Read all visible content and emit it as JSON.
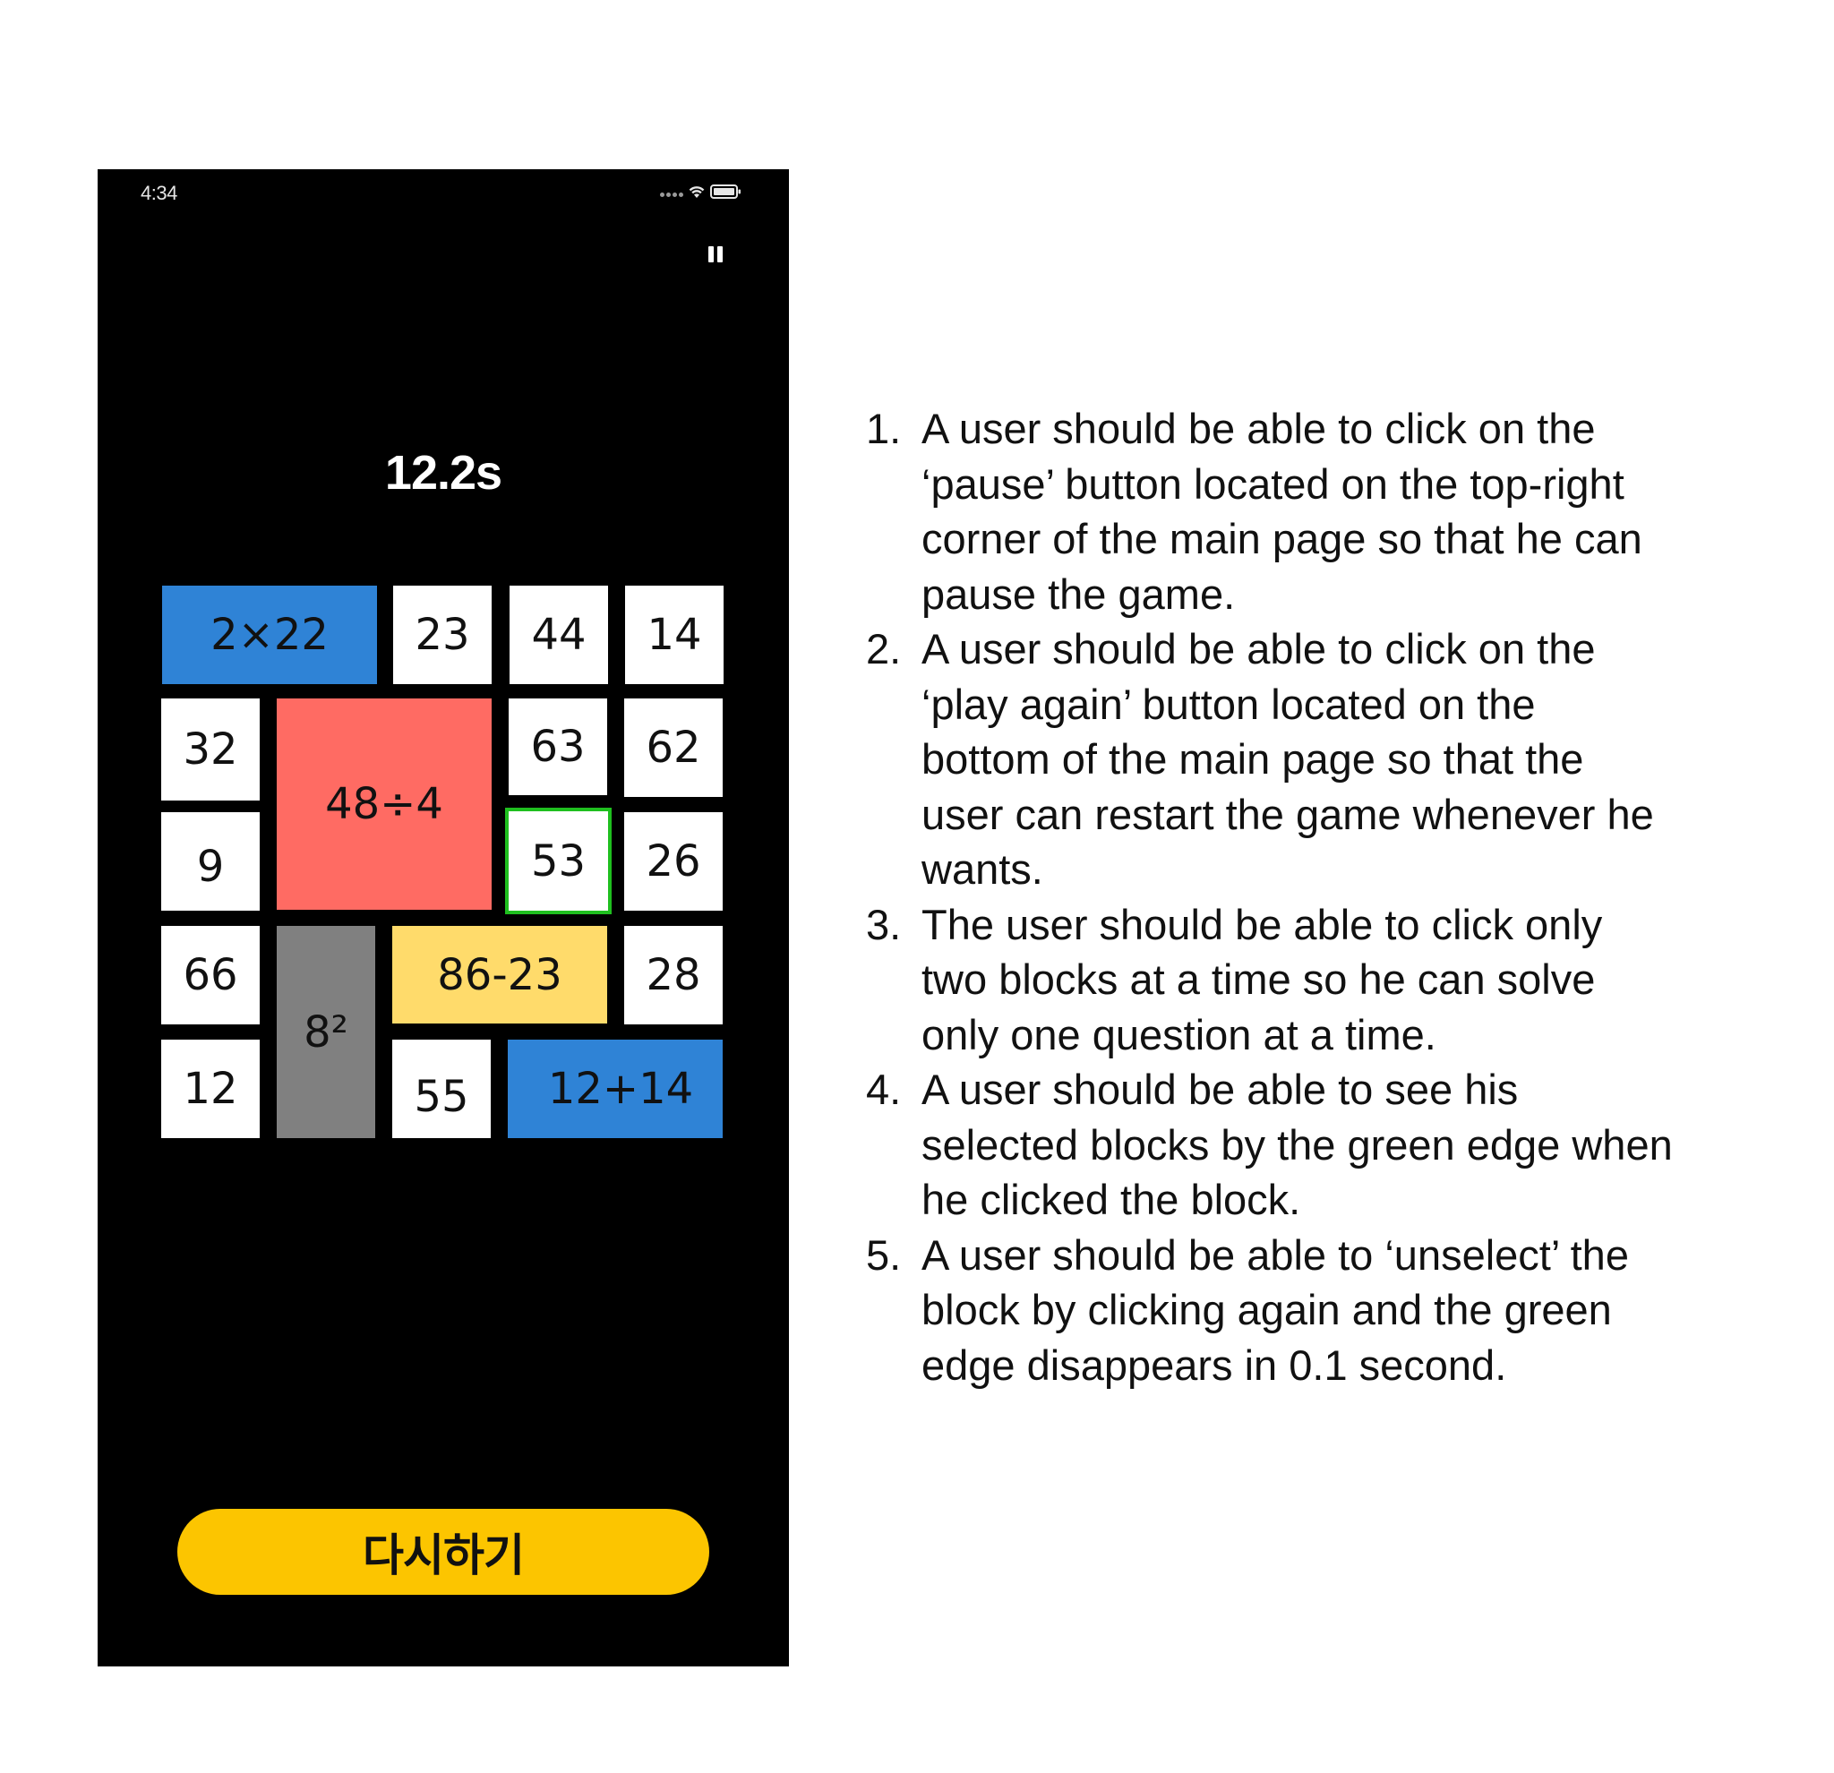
{
  "status_bar": {
    "time": "4:34",
    "icons": [
      "signal-dots-icon",
      "wifi-icon",
      "battery-icon"
    ]
  },
  "header": {
    "pause_icon": "pause-icon"
  },
  "timer": "12.2s",
  "blocks": [
    {
      "label": "2×22",
      "color": "#2f83d6",
      "selected": false
    },
    {
      "label": "23",
      "color": "#ffffff",
      "selected": false
    },
    {
      "label": "44",
      "color": "#ffffff",
      "selected": false
    },
    {
      "label": "14",
      "color": "#ffffff",
      "selected": false
    },
    {
      "label": "32",
      "color": "#ffffff",
      "selected": false
    },
    {
      "label": "48÷4",
      "color": "#ff6b63",
      "selected": false
    },
    {
      "label": "63",
      "color": "#ffffff",
      "selected": false
    },
    {
      "label": "62",
      "color": "#ffffff",
      "selected": false
    },
    {
      "label": "9",
      "color": "#ffffff",
      "selected": false
    },
    {
      "label": "53",
      "color": "#ffffff",
      "selected": true
    },
    {
      "label": "26",
      "color": "#ffffff",
      "selected": false
    },
    {
      "label": "66",
      "color": "#ffffff",
      "selected": false
    },
    {
      "label": "8²",
      "color": "#808080",
      "selected": false
    },
    {
      "label": "86-23",
      "color": "#ffdb6b",
      "selected": false
    },
    {
      "label": "28",
      "color": "#ffffff",
      "selected": false
    },
    {
      "label": "12",
      "color": "#ffffff",
      "selected": false
    },
    {
      "label": "55",
      "color": "#ffffff",
      "selected": false
    },
    {
      "label": "12+14",
      "color": "#2f83d6",
      "selected": false
    }
  ],
  "selected_edge_color": "#1fbf1f",
  "replay_button": {
    "label": "다시하기",
    "color": "#fcc500"
  },
  "requirements": [
    {
      "num": "1.",
      "lines": [
        "A user should be able to click on the",
        "‘pause’ button located on the top-right",
        "corner of the main page so that he can",
        "pause the game."
      ]
    },
    {
      "num": "2.",
      "lines": [
        "A user should be able to click on the",
        "‘play again’ button located on the",
        "bottom of the main page so that the",
        "user can restart the game whenever he",
        "wants."
      ]
    },
    {
      "num": "3.",
      "lines": [
        "The user should be able to click only",
        "two blocks at a time so he can solve",
        "only one question at a time."
      ]
    },
    {
      "num": "4.",
      "lines": [
        "A user should be able to see his",
        "selected blocks by the green edge when",
        "he clicked the block."
      ]
    },
    {
      "num": "5.",
      "lines": [
        "A user should be able to ‘unselect’ the",
        "block by clicking again and the green",
        "edge disappears in 0.1 second."
      ]
    }
  ]
}
